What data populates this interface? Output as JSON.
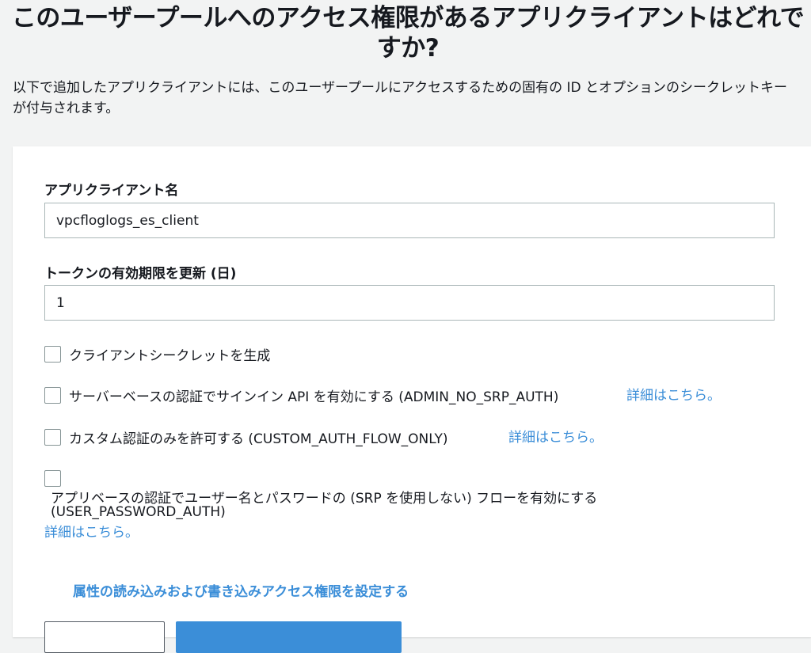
{
  "header": {
    "title": "このユーザープールへのアクセス権限があるアプリクライアントはどれですか?",
    "description": "以下で追加したアプリクライアントには、このユーザープールにアクセスするための固有の ID とオプションのシークレットキーが付与されます。"
  },
  "form": {
    "app_client_name_label": "アプリクライアント名",
    "app_client_name_value": "vpcfloglogs_es_client",
    "refresh_token_label": "トークンの有効期限を更新 (日)",
    "refresh_token_value": "1",
    "options": [
      {
        "label": "クライアントシークレットを生成",
        "checked": false
      },
      {
        "label": "サーバーベースの認証でサインイン API を有効にする (ADMIN_NO_SRP_AUTH)",
        "checked": false,
        "link": "詳細はこちら。"
      },
      {
        "label": "カスタム認証のみを許可する (CUSTOM_AUTH_FLOW_ONLY)",
        "checked": false,
        "link": "詳細はこちら。"
      },
      {
        "label": "アプリベースの認証でユーザー名とパスワードの (SRP を使用しない) フローを有効にする",
        "label_line2": "(USER_PASSWORD_AUTH)",
        "checked": false,
        "link": "詳細はこちら。"
      }
    ],
    "attributes_link": "属性の読み込みおよび書き込みアクセス権限を設定する"
  },
  "colors": {
    "link": "#3b8ed8",
    "primary_button": "#3b8ed8",
    "background": "#f2f3f3"
  }
}
